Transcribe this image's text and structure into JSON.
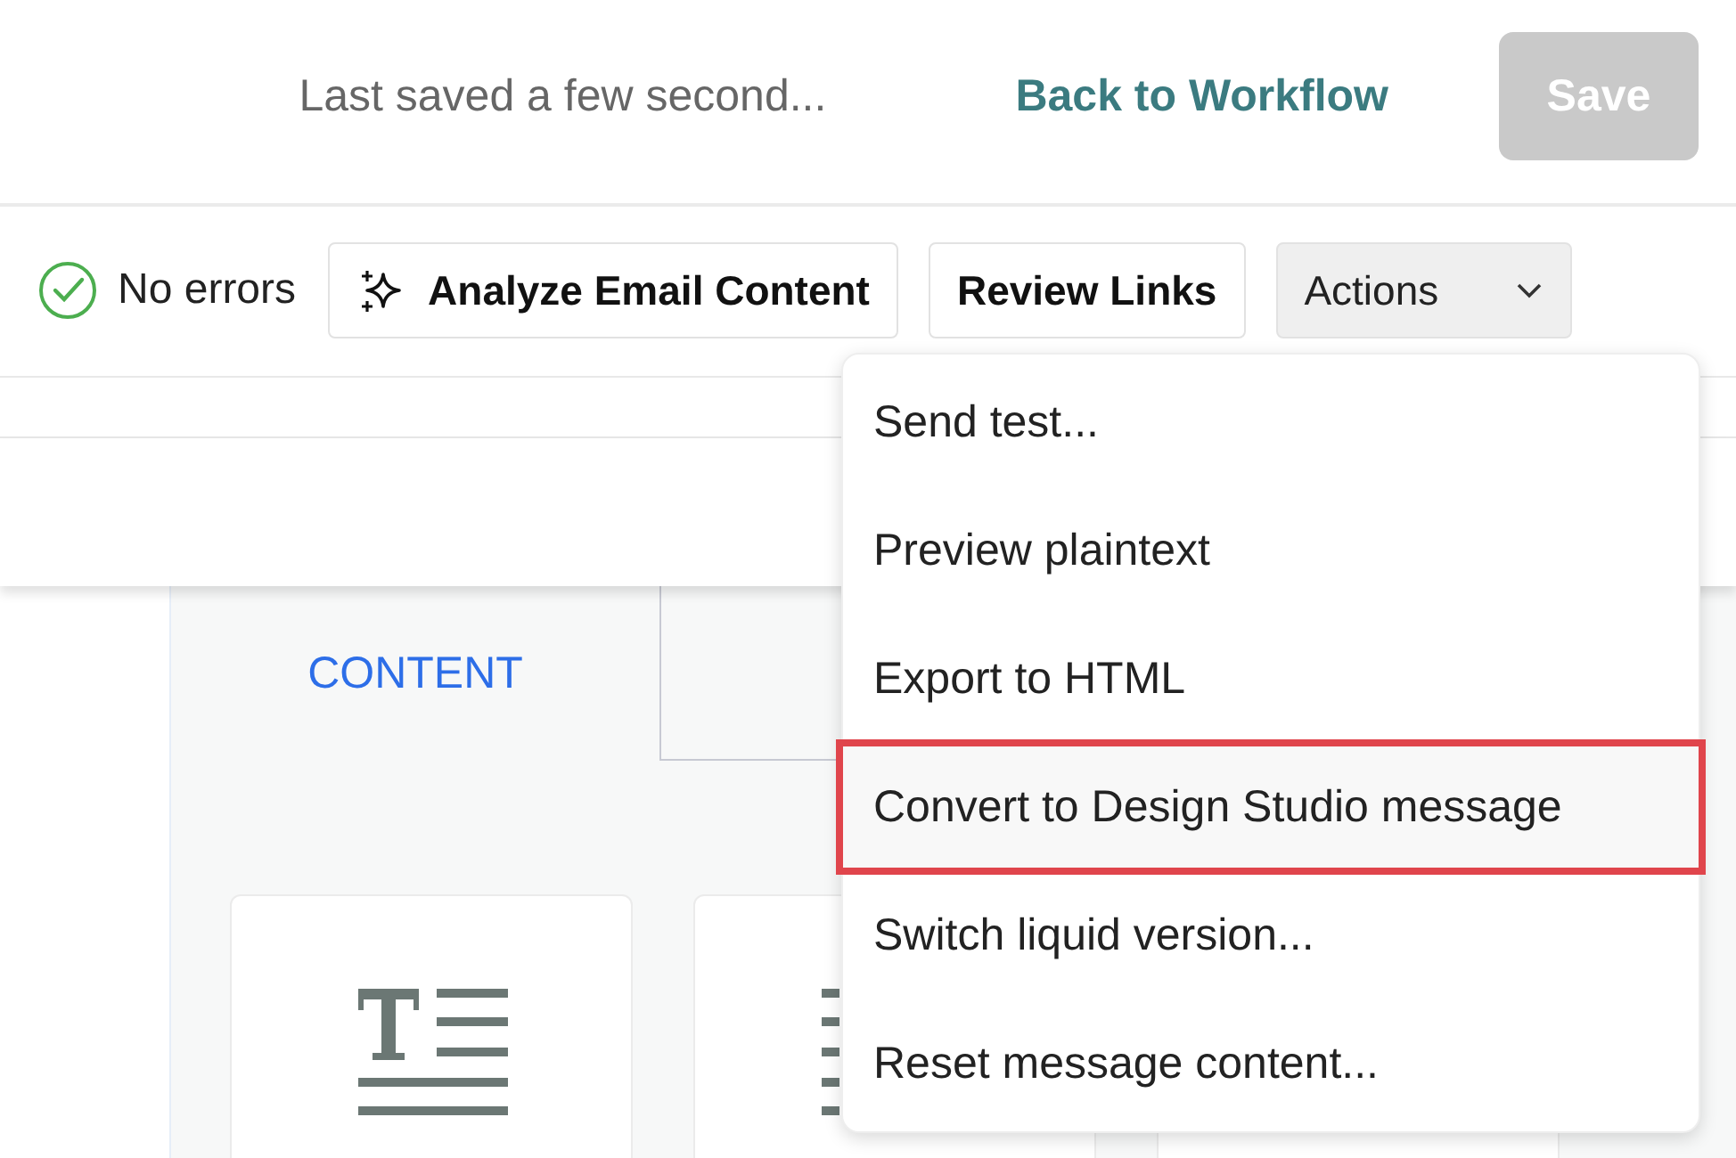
{
  "header": {
    "save_status": "Last saved a few second...",
    "back_link": "Back to Workflow",
    "save_button": {
      "label": "Save",
      "disabled": true
    }
  },
  "toolbar": {
    "status": {
      "label": "No errors"
    },
    "buttons": [
      {
        "label": "Analyze Email Content",
        "kind": "sparkle"
      },
      {
        "label": "Review Links",
        "kind": "plain"
      }
    ],
    "actions": {
      "label": "Actions",
      "expanded": true
    }
  },
  "tabs": [
    {
      "label": "CONTENT",
      "selected": true
    },
    {
      "selected": false
    }
  ],
  "blocks": [
    {
      "kind": "text"
    },
    {
      "kind": "list"
    },
    {
      "kind": "other"
    }
  ],
  "menu": [
    {
      "label": "Send test...",
      "highlighted": false
    },
    {
      "label": "Preview plaintext",
      "highlighted": false
    },
    {
      "label": "Export to HTML",
      "highlighted": false
    },
    {
      "label": "Convert to Design Studio message",
      "highlighted": true
    },
    {
      "label": "Switch liquid version...",
      "highlighted": false
    },
    {
      "label": "Reset message content...",
      "highlighted": false
    }
  ]
}
